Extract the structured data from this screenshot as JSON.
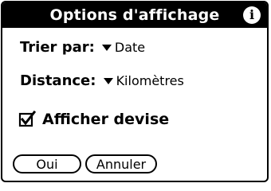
{
  "dialog": {
    "title": "Options d'affichage",
    "info_icon": "info-icon",
    "info_glyph": "i"
  },
  "sort": {
    "label": "Trier par:",
    "value": "Date"
  },
  "distance": {
    "label": "Distance:",
    "value": "Kilomètres"
  },
  "currency": {
    "label": "Afficher devise",
    "checked": true
  },
  "buttons": {
    "ok_label": "Oui",
    "cancel_label": "Annuler"
  }
}
